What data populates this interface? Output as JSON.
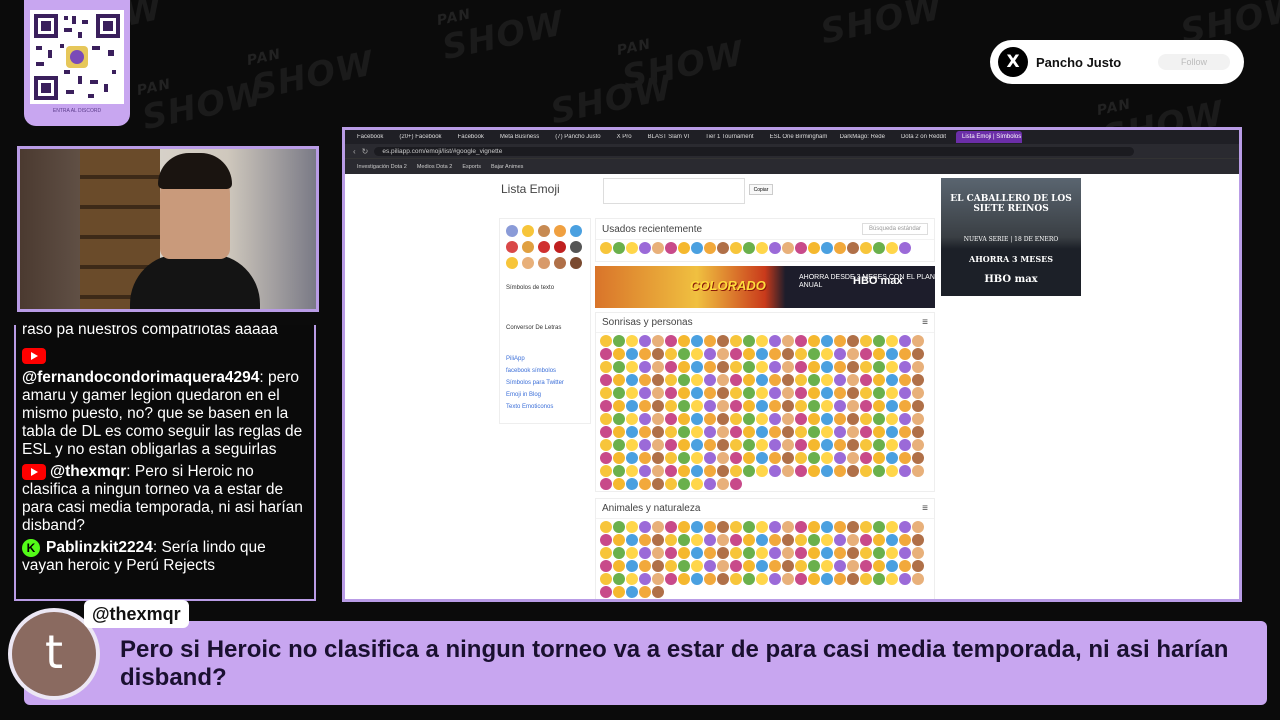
{
  "twitter": {
    "logo": "X",
    "name": "Pancho Justo",
    "follow": "Follow"
  },
  "qr": {
    "caption": "ENTRA AL DISCORD"
  },
  "chat": {
    "top_fragment": "raso pa nuestros compatriotas aaaaa",
    "messages": [
      {
        "platform": "youtube",
        "user": "@fernandocondorimaquera4294",
        "text": "pero amaru y gamer legion quedaron en el mismo puesto, no? que se basen en la tabla de DL es como seguir las reglas de ESL y no estan obligarlas a seguirlas"
      },
      {
        "platform": "youtube",
        "user": "@thexmqr",
        "text": "Pero si Heroic no clasifica a ningun torneo va a estar de para casi media temporada, ni asi harían disband?"
      },
      {
        "platform": "kick",
        "user": "Pablinzkit2224",
        "text": "Sería lindo que vayan heroic y Perú Rejects"
      }
    ]
  },
  "browser": {
    "tabs": [
      "Facebook",
      "(20+) Facebook",
      "Facebook",
      "Meta Business",
      "(7) Pancho Justo",
      "X Pro",
      "BLAST Slam VI",
      "Tier 1 Tournament",
      "ESL One Birmingham",
      "DarkMago: Rede",
      "Dota 2 on Reddit",
      "Lista Emoji | Símbolos emo"
    ],
    "url": "es.piliapp.com/emoji/list/#google_vignette",
    "bookmarks": [
      "Investigación Dota 2",
      "Medios Dota 2",
      "Esports",
      "Bajar Animes"
    ],
    "page": {
      "title": "Lista Emoji",
      "copy_button": "Copiar",
      "sidebar": {
        "simbolos": "Símbolos de texto",
        "conversor": "Conversor De Letras",
        "links": [
          "PiliApp",
          "facebook símbolos",
          "Símbolos para Twitter",
          "Emoji in Blog",
          "Texto Emoticonos"
        ]
      },
      "recent": {
        "title": "Usados recientemente",
        "search": "Búsqueda estándar"
      },
      "smileys": {
        "title": "Sonrisas y personas"
      },
      "animals": {
        "title": "Animales y naturaleza"
      },
      "ad_banner": {
        "brand": "COLORADO",
        "offer": "AHORRA DESDE 3 MESES CON EL PLAN ANUAL",
        "logo": "HBO max"
      },
      "side_ad": {
        "title": "EL CABALLERO DE LOS SIETE REINOS",
        "date": "NUEVA SERIE | 18 DE ENERO",
        "offer": "AHORRA 3 MESES",
        "logo": "HBO max"
      }
    }
  },
  "lower_third": {
    "avatar_letter": "t",
    "username": "@thexmqr",
    "message": "Pero si Heroic no clasifica a ningun torneo va a estar de para casi media temporada, ni asi harían disband?"
  },
  "colors": {
    "accent": "#c8a6f0",
    "youtube": "#ff0000",
    "kick": "#53fc18"
  }
}
